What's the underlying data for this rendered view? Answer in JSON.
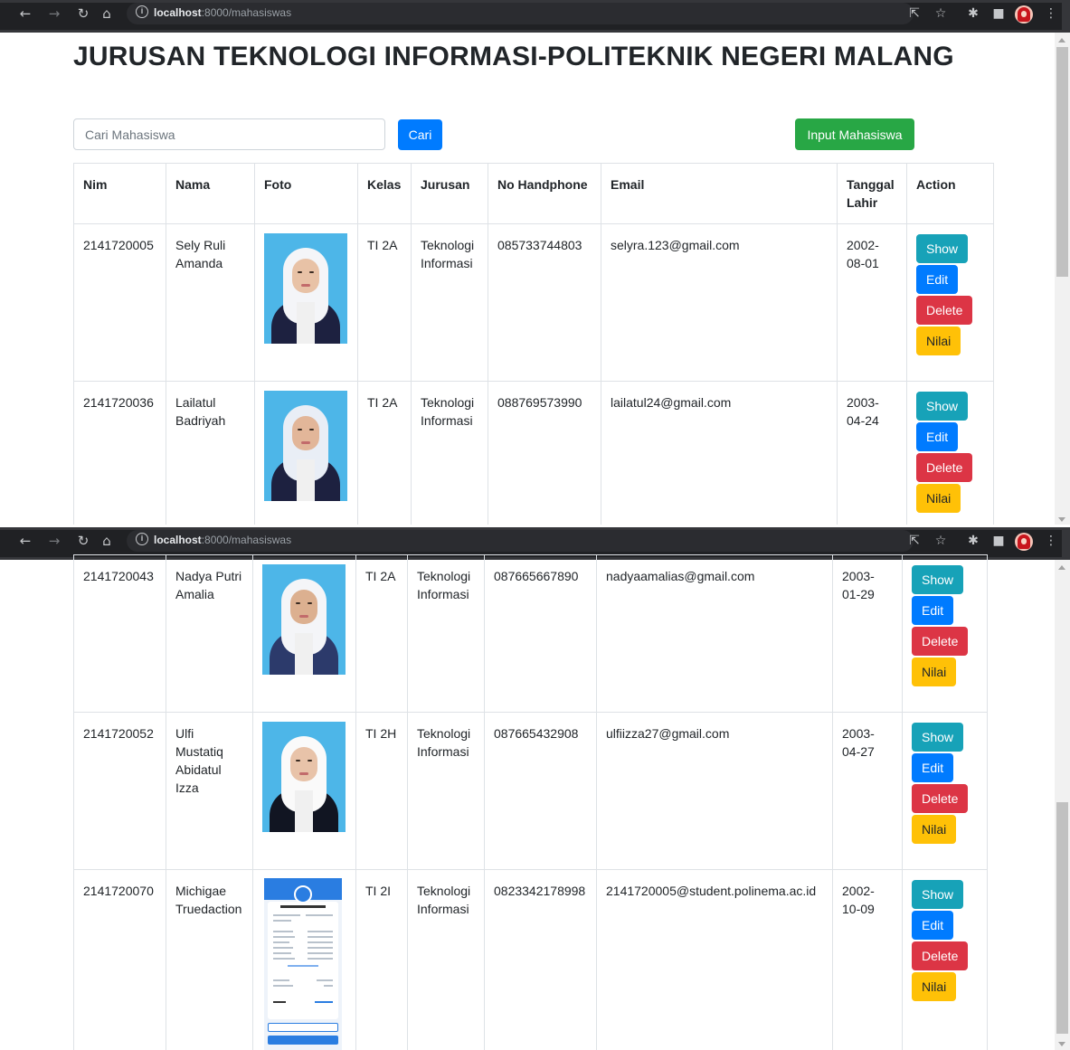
{
  "browser": {
    "url_host": "localhost",
    "url_path": ":8000/mahasiswas"
  },
  "page": {
    "title": "JURUSAN TEKNOLOGI INFORMASI-POLITEKNIK NEGERI MALANG",
    "search_placeholder": "Cari Mahasiswa",
    "search_button": "Cari",
    "input_button": "Input Mahasiswa"
  },
  "table": {
    "headers": {
      "nim": "Nim",
      "nama": "Nama",
      "foto": "Foto",
      "kelas": "Kelas",
      "jurusan": "Jurusan",
      "hp": "No Handphone",
      "email": "Email",
      "tgl": "Tanggal Lahir",
      "action": "Action"
    },
    "actions": {
      "show": "Show",
      "edit": "Edit",
      "delete": "Delete",
      "nilai": "Nilai"
    },
    "rows": [
      {
        "nim": "2141720005",
        "nama": "Sely Ruli Amanda",
        "kelas": "TI 2A",
        "jurusan": "Teknologi Informasi",
        "hp": "085733744803",
        "email": "selyra.123@gmail.com",
        "tgl": "2002-08-01"
      },
      {
        "nim": "2141720036",
        "nama": "Lailatul Badriyah",
        "kelas": "TI 2A",
        "jurusan": "Teknologi Informasi",
        "hp": "088769573990",
        "email": "lailatul24@gmail.com",
        "tgl": "2003-04-24"
      },
      {
        "nim": "2141720043",
        "nama": "Nadya Putri Amalia",
        "kelas": "TI 2A",
        "jurusan": "Teknologi Informasi",
        "hp": "087665667890",
        "email": "nadyaamalias@gmail.com",
        "tgl": "2003-01-29"
      },
      {
        "nim": "2141720052",
        "nama": "Ulfi Mustatiq Abidatul Izza",
        "kelas": "TI 2H",
        "jurusan": "Teknologi Informasi",
        "hp": "087665432908",
        "email": "ulfiizza27@gmail.com",
        "tgl": "2003-04-27"
      },
      {
        "nim": "2141720070",
        "nama": "Michigae Truedaction",
        "kelas": "TI 2I",
        "jurusan": "Teknologi Informasi",
        "hp": "0823342178998",
        "email": "2141720005@student.polinema.ac.id",
        "tgl": "2002-10-09"
      }
    ]
  },
  "colors": {
    "primary": "#007bff",
    "success": "#28a745",
    "info": "#17a2b8",
    "danger": "#dc3545",
    "warning": "#ffc107"
  }
}
